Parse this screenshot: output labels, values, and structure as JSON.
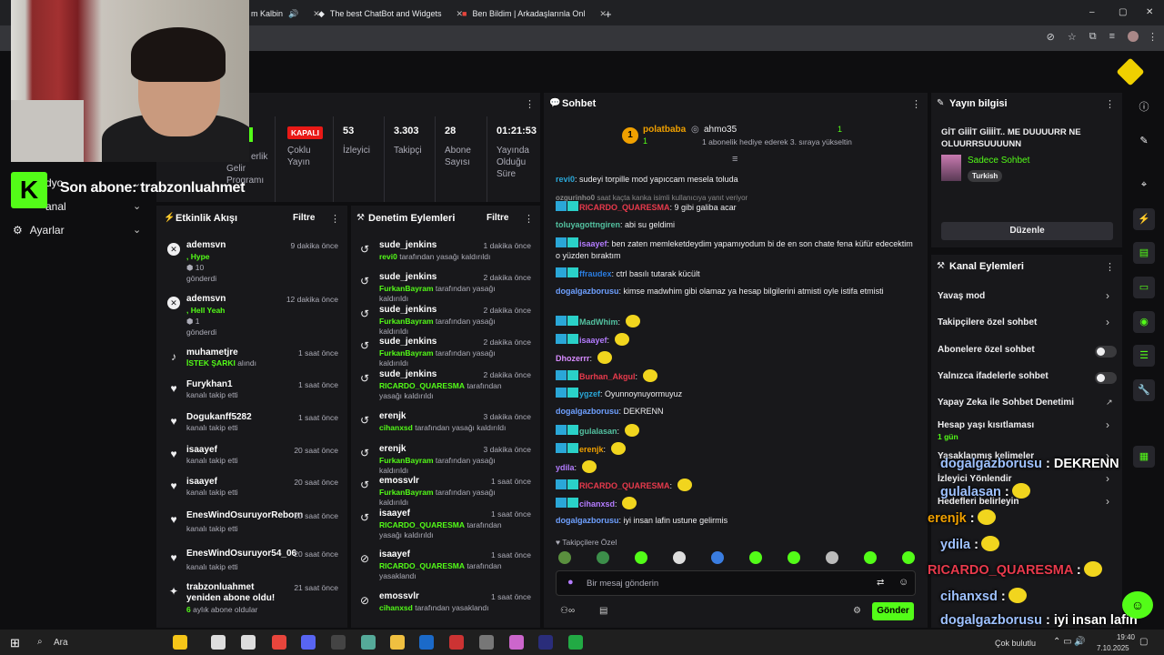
{
  "browser": {
    "tabs": [
      {
        "title": "m Kalbin"
      },
      {
        "title": "The best ChatBot and Widgets"
      },
      {
        "title": "Ben Bildim | Arkadaşlarınla Onl"
      }
    ],
    "new_tab": "+",
    "minimize": "–",
    "maximize": "▢",
    "close": "✕"
  },
  "overlay": {
    "last_sub_label": "Son abone: trabzonluahmet",
    "kick_letter": "K"
  },
  "sidebar": {
    "items": [
      {
        "label": "dyo"
      },
      {
        "label": "anal"
      },
      {
        "label": "Ayarlar"
      }
    ]
  },
  "stats": {
    "partial_label": "erlik",
    "partial_label2": "Gelir Programı",
    "status": "KAPALI",
    "status_sub": "Çoklu Yayın",
    "viewers": {
      "value": "53",
      "label": "İzleyici"
    },
    "followers": {
      "value": "3.303",
      "label": "Takipçi"
    },
    "subs": {
      "value": "28",
      "label": "Abone Sayısı"
    },
    "duration": {
      "value": "01:21:53",
      "label": "Yayında Olduğu Süre"
    }
  },
  "activity": {
    "title": "Etkinlik Akışı",
    "filter": "Filtre",
    "items": [
      {
        "user": "ademsvn",
        "line1": ", Hype",
        "line2": "10",
        "line3": "gönderdi",
        "time": "9 dakika önce",
        "icon": "x"
      },
      {
        "user": "ademsvn",
        "line1": ", Hell Yeah",
        "line2": "1",
        "line3": "gönderdi",
        "time": "12 dakika önce",
        "icon": "x"
      },
      {
        "user": "muhametjre",
        "line1": "İSTEK ŞARKI",
        "line2": "alındı",
        "time": "1 saat önce",
        "icon": "music"
      },
      {
        "user": "Furykhan1",
        "line1": "kanalı takip etti",
        "time": "1 saat önce",
        "icon": "heart"
      },
      {
        "user": "Dogukanff5282",
        "line1": "kanalı takip etti",
        "time": "1 saat önce",
        "icon": "heart"
      },
      {
        "user": "isaayef",
        "line1": "kanalı takip etti",
        "time": "20 saat önce",
        "icon": "heart"
      },
      {
        "user": "isaayef",
        "line1": "kanalı takip etti",
        "time": "20 saat önce",
        "icon": "heart"
      },
      {
        "user": "EnesWindOsuruyorReborn",
        "line1": "kanalı takip etti",
        "time": "20 saat önce",
        "icon": "heart"
      },
      {
        "user": "EnesWindOsuruyor54_06",
        "line1": "kanalı takip etti",
        "time": "20 saat önce",
        "icon": "heart"
      },
      {
        "user": "trabzonluahmet yeniden abone oldu!",
        "line1": "6",
        "line2": "aylık abone oldular",
        "time": "21 saat önce",
        "icon": "star"
      }
    ]
  },
  "moderation": {
    "title": "Denetim Eylemleri",
    "filter": "Filtre",
    "items": [
      {
        "user": "sude_jenkins",
        "actor": "revi0",
        "action": "tarafından yasağı kaldırıldı",
        "time": "1 dakika önce"
      },
      {
        "user": "sude_jenkins",
        "actor": "FurkanBayram",
        "action": "tarafından yasağı kaldırıldı",
        "time": "2 dakika önce"
      },
      {
        "user": "sude_jenkins",
        "actor": "FurkanBayram",
        "action": "tarafından yasağı kaldırıldı",
        "time": "2 dakika önce"
      },
      {
        "user": "sude_jenkins",
        "actor": "FurkanBayram",
        "action": "tarafından yasağı kaldırıldı",
        "time": "2 dakika önce"
      },
      {
        "user": "sude_jenkins",
        "actor": "RICARDO_QUARESMA",
        "action": "tarafından yasağı kaldırıldı",
        "time": "2 dakika önce"
      },
      {
        "user": "erenjk",
        "actor": "cihanxsd",
        "action": "tarafından yasağı kaldırıldı",
        "time": "3 dakika önce"
      },
      {
        "user": "erenjk",
        "actor": "FurkanBayram",
        "action": "tarafından yasağı kaldırıldı",
        "time": "3 dakika önce"
      },
      {
        "user": "emossvlr",
        "actor": "FurkanBayram",
        "action": "tarafından yasağı kaldırıldı",
        "time": "1 saat önce"
      },
      {
        "user": "isaayef",
        "actor": "RICARDO_QUARESMA",
        "action": "tarafından yasağı kaldırıldı",
        "time": "1 saat önce"
      },
      {
        "user": "isaayef",
        "actor": "RICARDO_QUARESMA",
        "action": "tarafından yasaklandı",
        "time": "1 saat önce"
      },
      {
        "user": "emossvlr",
        "actor": "cihanxsd",
        "action": "tarafından yasaklandı",
        "time": "1 saat önce"
      }
    ]
  },
  "chat": {
    "title": "Sohbet",
    "pinned_user1": "polatbaba",
    "pinned_user1_count": "1",
    "pinned_rank": "1",
    "pinned_user2": "ahmo35",
    "pinned_user2_count": "1",
    "pinned_text": "1 abonelik hediye ederek 3. sıraya yükseltin",
    "messages": [
      {
        "user": "revi0",
        "text": "sudeyi torpille mod yapıccam mesela toluda",
        "color": "#2aa7d8"
      },
      {
        "user": "ozgurinho0",
        "text": "saat kaçta kanka isimli kullanıcıya yanıt veriyor",
        "color": "#888"
      },
      {
        "user": "RICARDO_QUARESMA",
        "text": "9 gibi galiba acar",
        "color": "#e83a4c"
      },
      {
        "user": "toluyagottngiren",
        "text": "abi su geldimi",
        "color": "#53c1a0"
      },
      {
        "user": "isaayef",
        "text": "ben zaten memleketdeydim yapamıyodum bi de en son chate fena küfür edecektim o yüzden bıraktım",
        "color": "#b47cff"
      },
      {
        "user": "ffraudex",
        "text": "ctrl basılı tutarak kücült",
        "color": "#2a7de1"
      },
      {
        "user": "dogalgazborusu",
        "text": "kimse madwhim gibi olamaz ya hesap bilgilerini atmisti oyle istifa etmisti",
        "color": "#6ea0ff"
      },
      {
        "user": "MadWhim",
        "text": "",
        "color": "#53c1a0"
      },
      {
        "user": "isaayef",
        "text": "",
        "color": "#b47cff"
      },
      {
        "user": "Dhozerrr",
        "text": "",
        "color": "#d88cff"
      },
      {
        "user": "Burhan_Akgul",
        "text": "",
        "color": "#e83a4c"
      },
      {
        "user": "ygzef",
        "text": "Oyunnoynuyormuyuz",
        "color": "#2aa7d8"
      },
      {
        "user": "dogalgazborusu",
        "text": "DEKRENN",
        "color": "#6ea0ff"
      },
      {
        "user": "gulalasan",
        "text": "",
        "color": "#53c1a0"
      },
      {
        "user": "erenjk",
        "text": "",
        "color": "#f0a000"
      },
      {
        "user": "ydila",
        "text": "",
        "color": "#b47cff"
      },
      {
        "user": "RICARDO_QUARESMA",
        "text": "",
        "color": "#e83a4c"
      },
      {
        "user": "cihanxsd",
        "text": "",
        "color": "#b47cff"
      },
      {
        "user": "dogalgazborusu",
        "text": "iyi insan lafin ustune gelirmis",
        "color": "#6ea0ff"
      }
    ],
    "followers_only": "Takipçilere Özel",
    "input_placeholder": "Bir mesaj gönderin",
    "send_label": "Gönder"
  },
  "stream_info": {
    "title": "Yayın bilgisi",
    "stream_title": "GİT GİİİT GİİİİT.. ME DUUUURR NE OLUURRSUUUUNN",
    "category": "Sadece Sohbet",
    "language": "Turkish",
    "edit_label": "Düzenle"
  },
  "channel_actions": {
    "title": "Kanal Eylemleri",
    "items": [
      {
        "label": "Yavaş mod"
      },
      {
        "label": "Takipçilere özel sohbet"
      },
      {
        "label": "Abonelere özel sohbet"
      },
      {
        "label": "Yalnızca ifadelerle sohbet"
      },
      {
        "label": "Yapay Zeka ile Sohbet Denetimi"
      },
      {
        "label": "Hesap yaşı kısıtlaması",
        "sub": "1 gün"
      },
      {
        "label": "Yasaklanmış kelimeler"
      },
      {
        "label": "İzleyici Yönlendir"
      },
      {
        "label": "Hedefleri belirleyin"
      }
    ]
  },
  "overlay_chat": [
    {
      "user": "dogalgazborusu",
      "text": ": DEKRENN"
    },
    {
      "user": "gulalasan",
      "text": ":"
    },
    {
      "user": "erenjk",
      "text": ":"
    },
    {
      "user": "ydila",
      "text": ":"
    },
    {
      "user": "RICARDO_QUARESMA",
      "text": ":"
    },
    {
      "user": "cihanxsd",
      "text": ":"
    },
    {
      "user": "dogalgazborusu",
      "text": ": iyi insan lafin"
    },
    {
      "user": "",
      "text": "ustune gelirmis"
    }
  ],
  "taskbar": {
    "search": "Ara",
    "weather": "Çok bulutlu",
    "time": "19:40",
    "date": "7.10.2025"
  },
  "colors": {
    "brand": "#53fc18",
    "panel": "#18181b",
    "bg": "#0e0e10"
  }
}
